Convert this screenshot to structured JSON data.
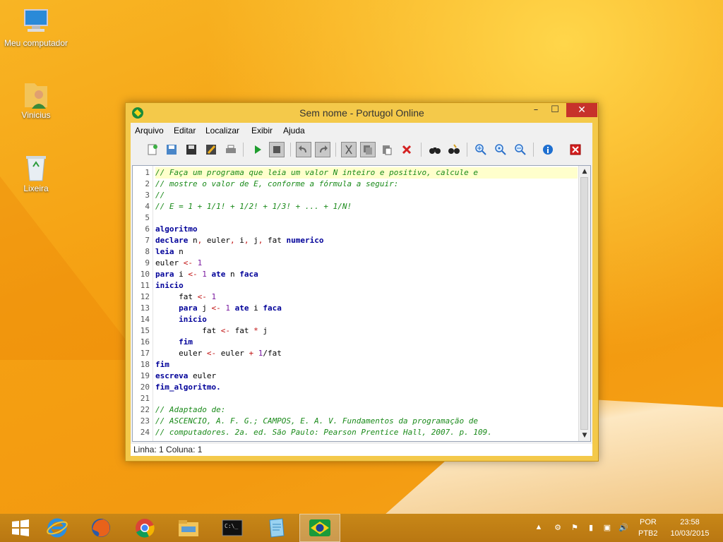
{
  "desktop": {
    "icons": [
      {
        "label": "Meu computador",
        "icon": "computer-icon"
      },
      {
        "label": "Vinicius",
        "icon": "user-folder-icon"
      },
      {
        "label": "Lixeira",
        "icon": "recycle-bin-icon"
      }
    ]
  },
  "window": {
    "title": "Sem nome - Portugol Online",
    "controls": {
      "minimize": "–",
      "maximize": "☐",
      "close": "✕"
    },
    "menu": [
      "Arquivo",
      "Editar",
      "Localizar",
      "Exibir",
      "Ajuda"
    ],
    "toolbar": [
      "new-file-icon",
      "save-icon",
      "save-all-icon",
      "edit-icon",
      "print-icon",
      "run-icon",
      "stop-icon",
      "undo-icon",
      "redo-icon",
      "cut-icon",
      "copy-icon",
      "paste-icon",
      "delete-icon",
      "find-icon",
      "replace-icon",
      "zoom-in-icon",
      "zoom-reset-icon",
      "zoom-out-icon",
      "info-icon",
      "exit-icon"
    ],
    "editor": {
      "line_numbers": [
        "1",
        "2",
        "3",
        "4",
        "5",
        "6",
        "7",
        "8",
        "9",
        "10",
        "11",
        "12",
        "13",
        "14",
        "15",
        "16",
        "17",
        "18",
        "19",
        "20",
        "21",
        "22",
        "23",
        "24"
      ],
      "lines": [
        "// Faça um programa que leia um valor N inteiro e positivo, calcule e",
        "// mostre o valor de E, conforme a fórmula a seguir:",
        "//",
        "// E = 1 + 1/1! + 1/2! + 1/3! + ... + 1/N!",
        "",
        "algoritmo",
        "declare n, euler, i, j, fat numerico",
        "leia n",
        "euler <- 1",
        "para i <- 1 ate n faca",
        "inicio",
        "     fat <- 1",
        "     para j <- 1 ate i faca",
        "     inicio",
        "          fat <- fat * j",
        "     fim",
        "     euler <- euler + 1/fat",
        "fim",
        "escreva euler",
        "fim_algoritmo.",
        "",
        "// Adaptado de:",
        "// ASCENCIO, A. F. G.; CAMPOS, E. A. V. Fundamentos da programação de",
        "// computadores. 2a. ed. São Paulo: Pearson Prentice Hall, 2007. p. 109."
      ]
    },
    "status": "Linha: 1 Coluna: 1"
  },
  "taskbar": {
    "items": [
      "windows-start-icon",
      "internet-explorer-icon",
      "firefox-icon",
      "chrome-icon",
      "file-explorer-icon",
      "command-prompt-icon",
      "notepad-icon",
      "portugol-icon"
    ],
    "language": "POR",
    "layout": "PTB2",
    "time": "23:58",
    "date": "10/03/2015"
  }
}
